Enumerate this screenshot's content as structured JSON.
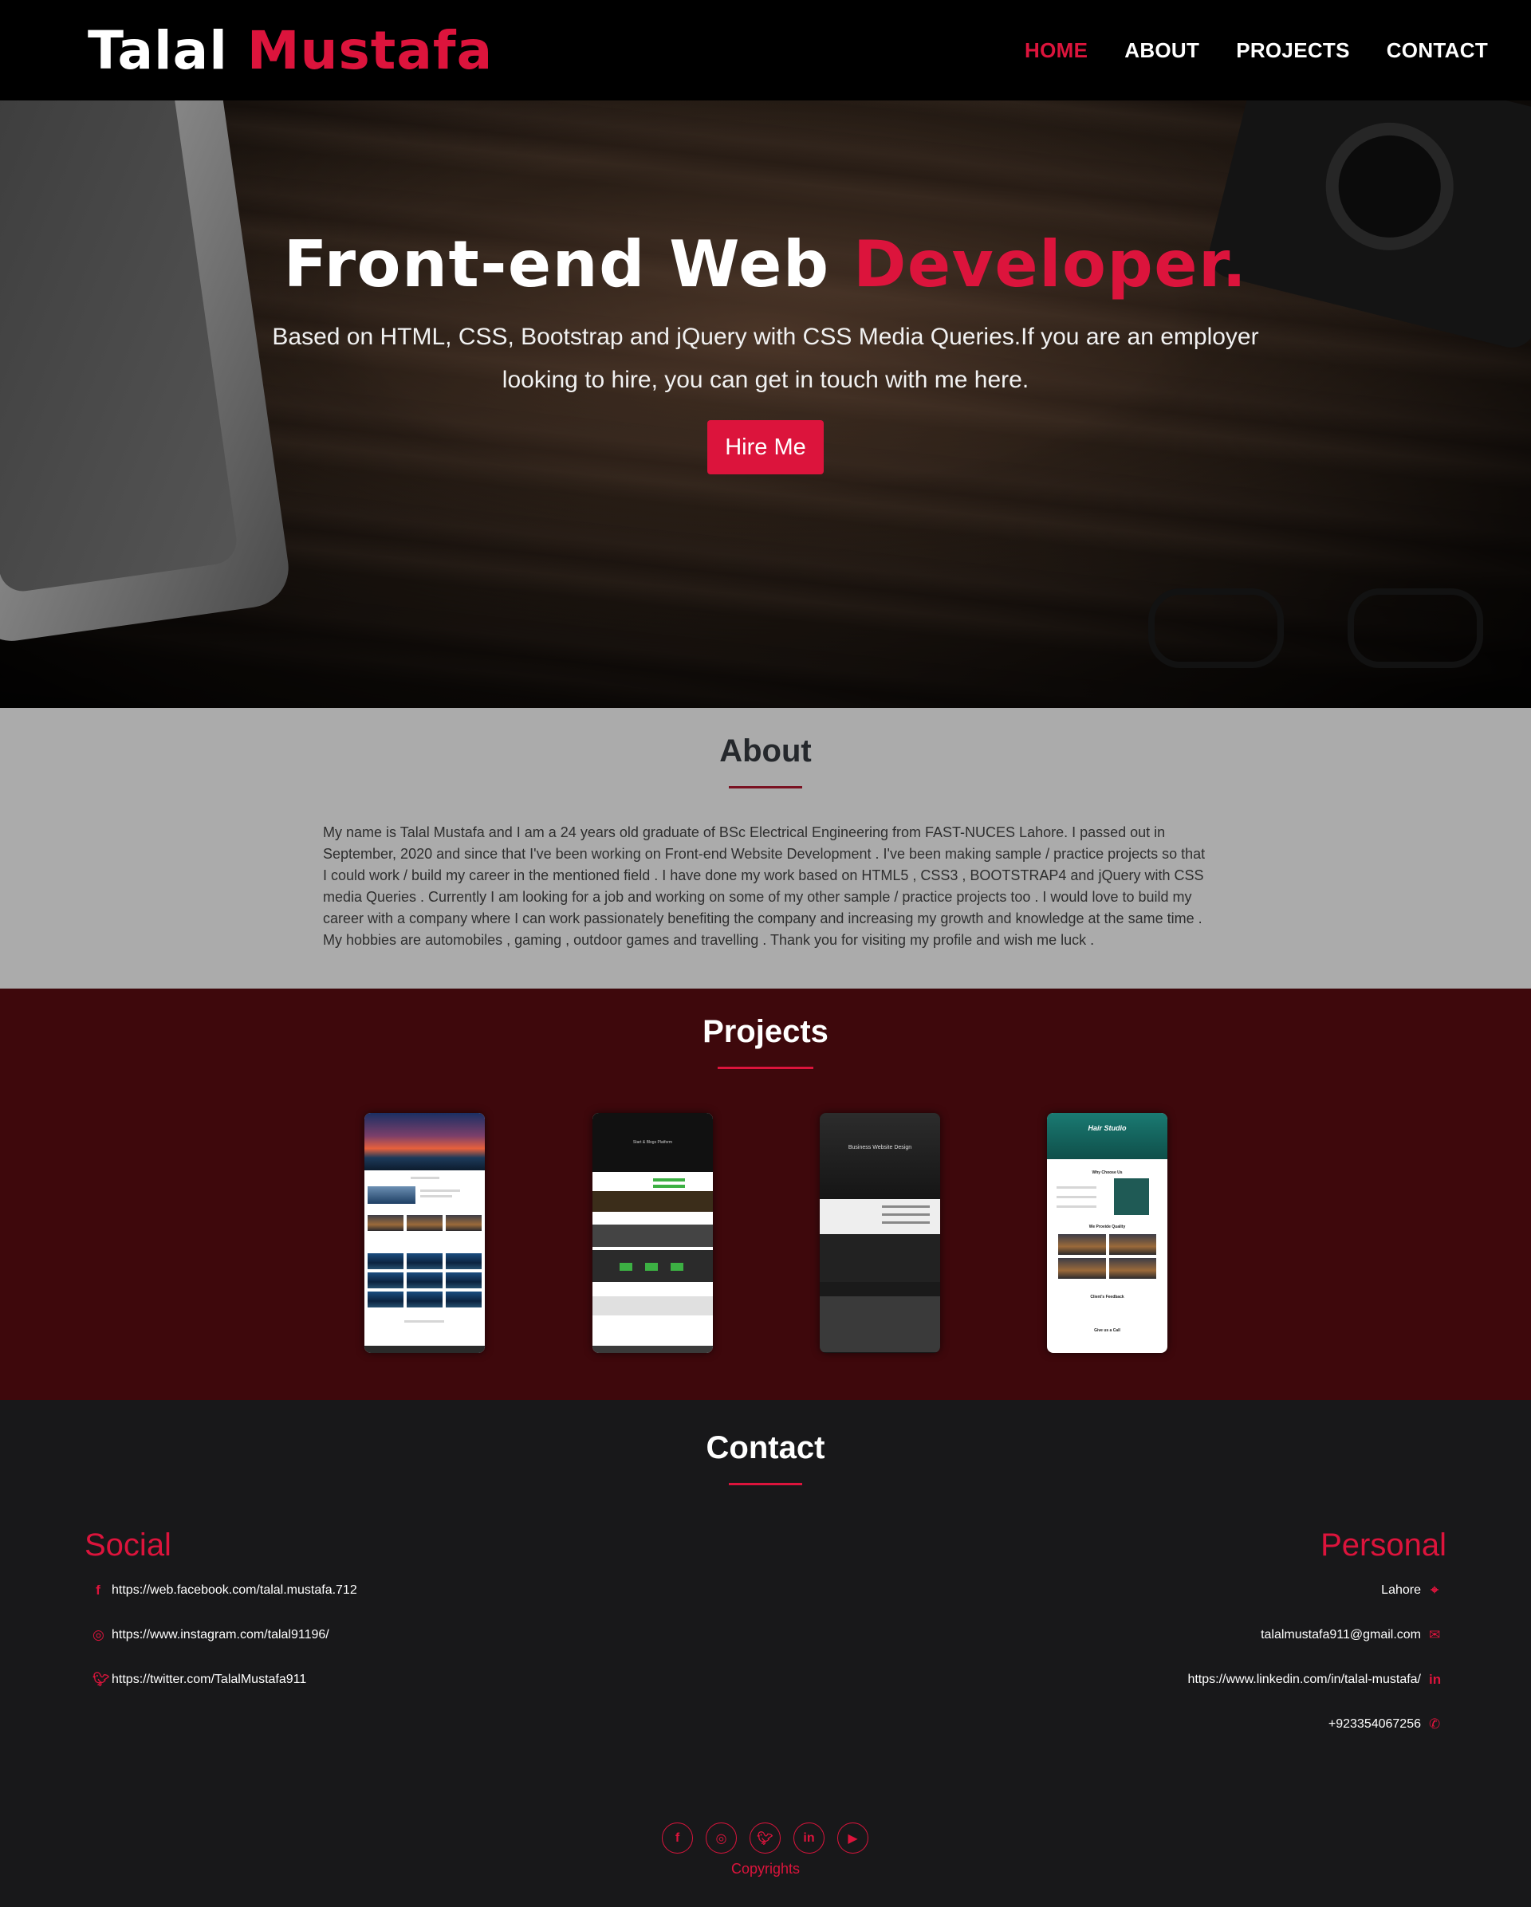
{
  "brand": {
    "first": "Talal",
    "last": "Mustafa"
  },
  "nav": {
    "home": "HOME",
    "about": "ABOUT",
    "projects": "PROJECTS",
    "contact": "CONTACT"
  },
  "hero": {
    "title_main": "Front-end Web",
    "title_accent": "Developer.",
    "subtitle": "Based on HTML, CSS, Bootstrap and jQuery with CSS Media Queries.If you are an employer looking to hire, you can get in touch with me here.",
    "button": "Hire Me"
  },
  "about": {
    "title": "About",
    "text": "My name is Talal Mustafa and I am a 24 years old graduate of BSc Electrical Engineering from FAST-NUCES Lahore. I passed out in September, 2020 and since that I've been working on Front-end Website Development . I've been making sample / practice projects so that I could work / build my career in the mentioned field . I have done my work based on HTML5 , CSS3 , BOOTSTRAP4 and jQuery with CSS media Queries . Currently I am looking for a job and working on some of my other sample / practice projects too . I would love to build my career with a company where I can work passionately benefiting the company and increasing my growth and knowledge at the same time . My hobbies are automobiles , gaming , outdoor games and travelling . Thank you for visiting my profile and wish me luck ."
  },
  "projects": {
    "title": "Projects",
    "cards": {
      "p2_heading": "Start & Blogs Platform",
      "p3_heading": "Business Website Design",
      "p4_heading": "Hair Studio",
      "p4_why": "Why Choose Us",
      "p4_quality": "We Provide Quality",
      "p4_feedback": "Client's Feedback",
      "p4_call": "Give us a Call"
    }
  },
  "contact": {
    "title": "Contact",
    "social_heading": "Social",
    "personal_heading": "Personal",
    "social": {
      "facebook": "https://web.facebook.com/talal.mustafa.712",
      "instagram": "https://www.instagram.com/talal91196/",
      "twitter": "https://twitter.com/TalalMustafa911"
    },
    "personal": {
      "location": "Lahore",
      "email": "talalmustafa911@gmail.com",
      "linkedin": "https://www.linkedin.com/in/talal-mustafa/",
      "phone": "+923354067256"
    },
    "copyright": "Copyrights"
  },
  "icons": {
    "facebook": "facebook-icon",
    "instagram": "instagram-icon",
    "twitter": "twitter-icon",
    "linkedin": "linkedin-icon",
    "youtube": "youtube-icon",
    "location": "map-marker-icon",
    "email": "envelope-icon",
    "phone": "phone-icon"
  },
  "colors": {
    "accent": "#dc143c",
    "nav_bg": "#000000",
    "about_bg": "#ababab",
    "projects_bg": "#3e080c",
    "contact_bg": "#18181a"
  }
}
